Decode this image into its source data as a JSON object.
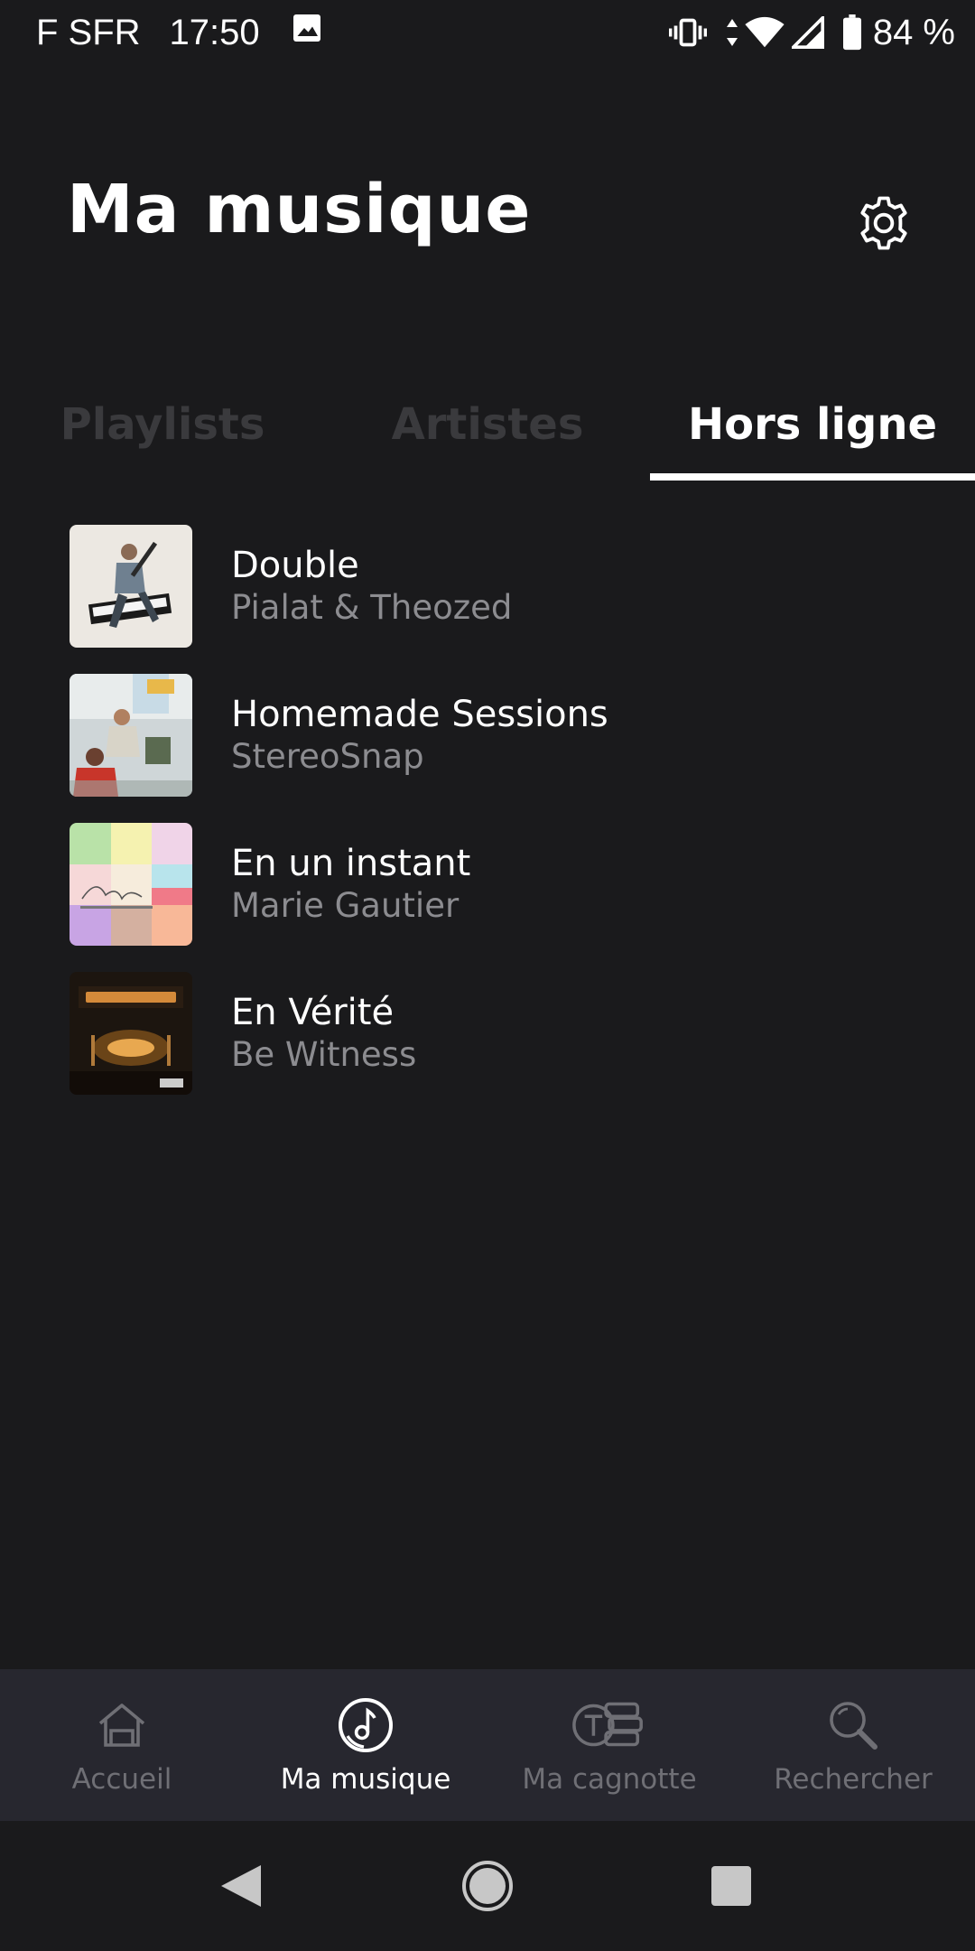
{
  "status_bar": {
    "carrier": "F SFR",
    "time": "17:50",
    "battery_percent": "84 %",
    "icons": [
      "image-icon",
      "vibrate-icon",
      "data-arrows-icon",
      "wifi-icon",
      "signal-icon",
      "battery-icon"
    ]
  },
  "header": {
    "title": "Ma musique",
    "settings_icon": "gear-icon"
  },
  "tabs": [
    {
      "label": "Playlists",
      "active": false
    },
    {
      "label": "Artistes",
      "active": false
    },
    {
      "label": "Hors ligne",
      "active": true
    }
  ],
  "albums": [
    {
      "title": "Double",
      "artist": "Pialat & Theozed"
    },
    {
      "title": "Homemade Sessions",
      "artist": "StereoSnap"
    },
    {
      "title": "En un instant",
      "artist": "Marie Gautier"
    },
    {
      "title": "En Vérité",
      "artist": "Be Witness"
    }
  ],
  "bottom_nav": [
    {
      "label": "Accueil",
      "icon": "home-icon",
      "active": false
    },
    {
      "label": "Ma musique",
      "icon": "music-disc-icon",
      "active": true
    },
    {
      "label": "Ma cagnotte",
      "icon": "token-stack-icon",
      "active": false
    },
    {
      "label": "Rechercher",
      "icon": "search-icon",
      "active": false
    }
  ],
  "system_nav": {
    "icons": [
      "back-icon",
      "home-circle-icon",
      "recents-icon"
    ]
  },
  "colors": {
    "background": "#1a1a1c",
    "bottom_nav_bg": "#27272f",
    "inactive_tab": "#3a3a3d",
    "secondary_text": "#8c8c90",
    "nav_inactive": "#6f6f75",
    "active": "#ffffff"
  }
}
